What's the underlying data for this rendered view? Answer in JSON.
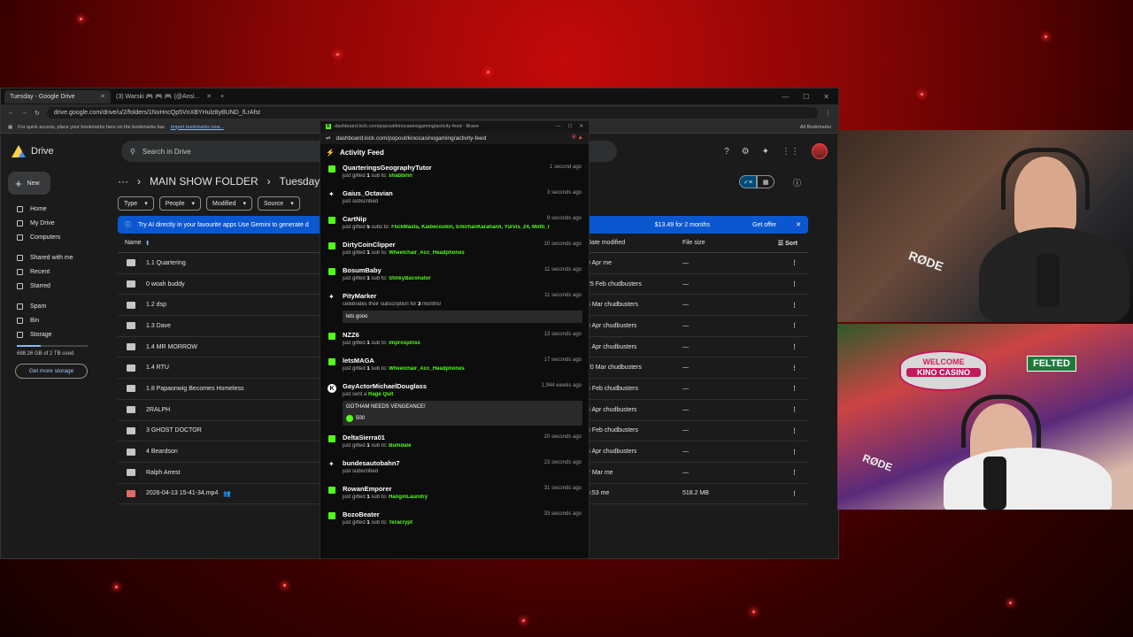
{
  "browser": {
    "tabs": [
      {
        "label": "Tuesday - Google Drive",
        "active": true
      },
      {
        "label": "(3) Warski 🎮 🎮 🎮 (@Ansi...",
        "active": false
      }
    ],
    "url": "drive.google.com/drive/u/2/folders/1NxHncQp5VnXBYHulz8yBUND_fLrAfst",
    "bookmarks_hint": "For quick access, place your bookmarks here on the bookmarks bar.",
    "bookmarks_link": "Import bookmarks now...",
    "all_bookmarks": "All Bookmarks"
  },
  "drive": {
    "app_name": "Drive",
    "search_placeholder": "Search in Drive",
    "new_label": "New",
    "sidebar": [
      {
        "label": "Home"
      },
      {
        "label": "My Drive"
      },
      {
        "label": "Computers"
      },
      {
        "label": "Shared with me"
      },
      {
        "label": "Recent"
      },
      {
        "label": "Starred"
      },
      {
        "label": "Spam"
      },
      {
        "label": "Bin"
      },
      {
        "label": "Storage"
      }
    ],
    "storage_text": "688.26 GB of 2 TB used",
    "storage_used_fraction": 0.34,
    "get_storage": "Get more storage",
    "breadcrumb": [
      "MAIN SHOW FOLDER",
      "Tuesday"
    ],
    "filters": [
      "Type",
      "People",
      "Modified",
      "Source"
    ],
    "banner_text": "Try AI directly in your favourite apps Use Gemini to generate d",
    "banner_price": "$13.49 for 2 months",
    "banner_button": "Get offer",
    "columns": {
      "name": "Name",
      "date": "Date modified",
      "size": "File size",
      "sort": "Sort"
    },
    "rows": [
      {
        "name": "1.1 Quartering",
        "date": "9 Apr me",
        "size": "—",
        "type": "folder"
      },
      {
        "name": "0 woah buddy",
        "date": "25 Feb chudbusters",
        "size": "—",
        "type": "folder"
      },
      {
        "name": "1.2 dsp",
        "date": "6 Mar chudbusters",
        "size": "—",
        "type": "folder"
      },
      {
        "name": "1.3 Dave",
        "date": "3 Apr chudbusters",
        "size": "—",
        "type": "folder"
      },
      {
        "name": "1.4 MR MORROW",
        "date": "1 Apr chudbusters",
        "size": "—",
        "type": "folder"
      },
      {
        "name": "1.4 RTU",
        "date": "20 Mar chudbusters",
        "size": "—",
        "type": "folder"
      },
      {
        "name": "1.8 Papaonwig Becomes Homeless",
        "date": "6 Feb chudbusters",
        "size": "—",
        "type": "folder"
      },
      {
        "name": "2RALPH",
        "date": "3 Apr chudbusters",
        "size": "—",
        "type": "folder"
      },
      {
        "name": "3 GHOST DOCTOR",
        "date": "8 Feb chudbusters",
        "size": "—",
        "type": "folder"
      },
      {
        "name": "4 Beardson",
        "date": "5 Apr chudbusters",
        "size": "—",
        "type": "folder"
      },
      {
        "name": "Ralph Arrest",
        "date": "2 Mar me",
        "size": "—",
        "type": "folder"
      },
      {
        "name": "2026-04-13 15-41-34.mp4",
        "date": "5:53 me",
        "size": "518.2 MB",
        "type": "video"
      }
    ]
  },
  "popout": {
    "window_title": "dashboard.kick.com/popout/kinocasinogaming/activity-feed - Brave",
    "url": "dashboard.kick.com/popout/kinocasinogaming/activity-feed",
    "feed_title": "Activity Feed",
    "events": [
      {
        "kind": "gift",
        "name": "QuarteringsGeographyTutor",
        "time": "1 second ago",
        "pre": "just gifted ",
        "count": "1",
        "mid": " sub to: ",
        "target": "shabbinn"
      },
      {
        "kind": "sub",
        "name": "Gaius_Octavian",
        "time": "3 seconds ago",
        "pre": "just subscribed",
        "count": "",
        "mid": "",
        "target": ""
      },
      {
        "kind": "gift",
        "name": "CartNip",
        "time": "9 seconds ago",
        "pre": "just gifted ",
        "count": "5",
        "mid": " subs to: ",
        "target": "FlickMasta, Kaibecookin, EmirhanKarahanli, Yurvis_24, Motti_r"
      },
      {
        "kind": "gift",
        "name": "DirtyCoinClipper",
        "time": "10 seconds ago",
        "pre": "just gifted ",
        "count": "1",
        "mid": " sub to: ",
        "target": "Wheelchair_Acc_Headphones"
      },
      {
        "kind": "gift",
        "name": "BosumBaby",
        "time": "11 seconds ago",
        "pre": "just gifted ",
        "count": "1",
        "mid": " sub to: ",
        "target": "StinkyBaconator"
      },
      {
        "kind": "resub",
        "name": "PityMarker",
        "time": "11 seconds ago",
        "pre": "celebrates their subscription for ",
        "count": "3",
        "mid": " months!",
        "target": "",
        "message": "lets gooo"
      },
      {
        "kind": "gift",
        "name": "NZZ6",
        "time": "13 seconds ago",
        "pre": "just gifted ",
        "count": "1",
        "mid": " sub to: ",
        "target": "improspinss"
      },
      {
        "kind": "gift",
        "name": "letsMAGA",
        "time": "17 seconds ago",
        "pre": "just gifted ",
        "count": "1",
        "mid": " sub to: ",
        "target": "Wheelchair_Acc_Headphones"
      },
      {
        "kind": "kicks",
        "name": "GayActorMichaelDouglass",
        "time": "1,944 weeks ago",
        "pre": "just sent a ",
        "count": "",
        "mid": "",
        "target": "Rage Quit",
        "message": "GOTHAM NEEDS VENGEANCE!",
        "amount": "500"
      },
      {
        "kind": "gift",
        "name": "DeltaSierra01",
        "time": "20 seconds ago",
        "pre": "just gifted ",
        "count": "1",
        "mid": " sub to: ",
        "target": "Bumdale"
      },
      {
        "kind": "sub",
        "name": "bundesautobahn7",
        "time": "23 seconds ago",
        "pre": "just subscribed",
        "count": "",
        "mid": "",
        "target": ""
      },
      {
        "kind": "gift",
        "name": "RowanEmporer",
        "time": "31 seconds ago",
        "pre": "just gifted ",
        "count": "1",
        "mid": " sub to: ",
        "target": "HanginLaundry"
      },
      {
        "kind": "gift",
        "name": "BozoBeater",
        "time": "33 seconds ago",
        "pre": "just gifted ",
        "count": "1",
        "mid": " sub to: ",
        "target": "Teracrypt"
      }
    ]
  },
  "cams": {
    "mic_brand": "RØDE",
    "sign_welcome": "WELCOME",
    "sign_name": "KINO CASINO",
    "street_sign": "FELTED"
  },
  "colors": {
    "kick_green": "#53fc18",
    "drive_banner": "#0b57d0",
    "background_red": "#8a0505"
  }
}
